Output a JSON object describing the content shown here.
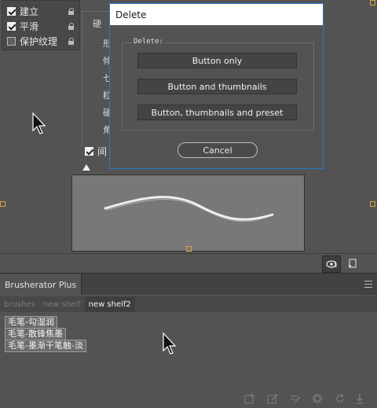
{
  "brush_options": {
    "items": [
      {
        "label": "建立",
        "checked": true
      },
      {
        "label": "平滑",
        "checked": true
      },
      {
        "label": "保护纹理",
        "checked": false
      }
    ],
    "sub_labels": [
      "硬",
      "形",
      "倾",
      "七",
      "粒",
      "硬",
      "角"
    ],
    "sub_top_label": "硬",
    "spacing_label": "间"
  },
  "dialog": {
    "title": "Delete",
    "group_label": "Delete:",
    "buttons": [
      "Button only",
      "Button and thumbnails",
      "Button, thumbnails and preset"
    ],
    "cancel_label": "Cancel"
  },
  "panel": {
    "title": "Brusherator Plus",
    "shelves": [
      {
        "label": "brushes",
        "active": false
      },
      {
        "label": "new shelf",
        "active": false
      },
      {
        "label": "new shelf2",
        "active": true
      }
    ],
    "brushes": [
      "毛笔-勾湿润",
      "毛笔-散锋焦墨",
      "毛笔-墨渐干笔触-淡"
    ]
  },
  "colors": {
    "background": "#535353",
    "dialog_border": "#2b78c8",
    "handle": "#d6a63a"
  }
}
